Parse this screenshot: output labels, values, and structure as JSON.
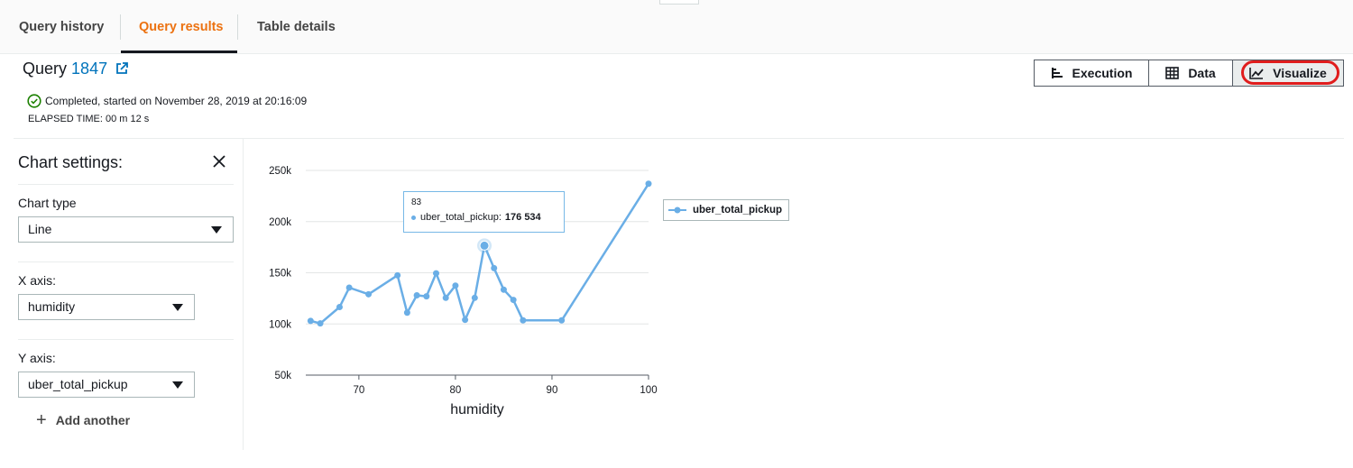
{
  "tabs": [
    {
      "label": "Query history",
      "active": false
    },
    {
      "label": "Query results",
      "active": true
    },
    {
      "label": "Table details",
      "active": false
    }
  ],
  "query": {
    "title_prefix": "Query",
    "id": "1847",
    "status_text": "Completed, started on November 28, 2019 at 20:16:09",
    "elapsed": "ELAPSED TIME: 00 m 12 s"
  },
  "view_buttons": {
    "execution": "Execution",
    "data": "Data",
    "visualize": "Visualize",
    "active": "visualize"
  },
  "settings": {
    "title": "Chart settings:",
    "chart_type_label": "Chart type",
    "chart_type_value": "Line",
    "x_axis_label": "X axis:",
    "x_axis_value": "humidity",
    "y_axis_label": "Y axis:",
    "y_axis_value": "uber_total_pickup",
    "add_another": "Add another"
  },
  "tooltip": {
    "x": "83",
    "series": "uber_total_pickup:",
    "value": "176 534"
  },
  "colors": {
    "accent": "#ec7211",
    "link": "#0073bb",
    "series": "#6aaee6",
    "highlight": "#e01d1d",
    "success": "#1d8102"
  },
  "chart_data": {
    "type": "line",
    "xlabel": "humidity",
    "ylabel": "",
    "x_ticks": [
      70,
      80,
      90,
      100
    ],
    "y_ticks": [
      50000,
      100000,
      150000,
      200000,
      250000
    ],
    "y_tick_labels": [
      "50k",
      "100k",
      "150k",
      "200k",
      "250k"
    ],
    "xlim": [
      64.5,
      100
    ],
    "ylim": [
      50000,
      250000
    ],
    "grid": true,
    "legend": "right",
    "series": [
      {
        "name": "uber_total_pickup",
        "points": [
          [
            65,
            103000
          ],
          [
            66,
            100500
          ],
          [
            68,
            116500
          ],
          [
            69,
            135500
          ],
          [
            71,
            129000
          ],
          [
            74,
            147500
          ],
          [
            75,
            111000
          ],
          [
            76,
            128000
          ],
          [
            77,
            127000
          ],
          [
            78,
            149500
          ],
          [
            79,
            125500
          ],
          [
            80,
            137500
          ],
          [
            81,
            104000
          ],
          [
            82,
            125500
          ],
          [
            83,
            176534
          ],
          [
            84,
            154500
          ],
          [
            85,
            133500
          ],
          [
            86,
            123500
          ],
          [
            87,
            103500
          ],
          [
            91,
            103500
          ],
          [
            100,
            237000
          ]
        ]
      }
    ],
    "highlight_x": 83
  }
}
